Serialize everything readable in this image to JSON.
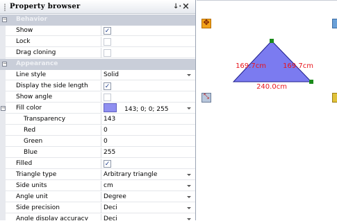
{
  "panel": {
    "title": "Property browser",
    "pin_glyph": "↓·",
    "close_glyph": "×"
  },
  "rows": [
    {
      "type": "category",
      "label": "Behavior",
      "expanded": true
    },
    {
      "type": "check",
      "label": "Show",
      "checked": true
    },
    {
      "type": "check",
      "label": "Lock",
      "checked": false
    },
    {
      "type": "check",
      "label": "Drag cloning",
      "checked": false
    },
    {
      "type": "category",
      "label": "Appearance",
      "expanded": true
    },
    {
      "type": "dropdown",
      "label": "Line style",
      "value": "Solid"
    },
    {
      "type": "check",
      "label": "Display the side length",
      "checked": true
    },
    {
      "type": "check",
      "label": "Show angle",
      "checked": false
    },
    {
      "type": "color",
      "label": "Fill color",
      "value": "143; 0; 0; 255",
      "color": "#8f8ff0",
      "expanded": true
    },
    {
      "type": "text",
      "label": "Transparency",
      "value": "143",
      "sub": true
    },
    {
      "type": "text",
      "label": "Red",
      "value": "0",
      "sub": true
    },
    {
      "type": "text",
      "label": "Green",
      "value": "0",
      "sub": true
    },
    {
      "type": "text",
      "label": "Blue",
      "value": "255",
      "sub": true
    },
    {
      "type": "check",
      "label": "Filled",
      "checked": true
    },
    {
      "type": "dropdown",
      "label": "Triangle type",
      "value": "Arbitrary triangle"
    },
    {
      "type": "dropdown",
      "label": "Side units",
      "value": "cm"
    },
    {
      "type": "dropdown",
      "label": "Angle unit",
      "value": "Degree"
    },
    {
      "type": "dropdown",
      "label": "Side precision",
      "value": "Deci"
    },
    {
      "type": "dropdown",
      "label": "Angle display accuracy",
      "value": "Deci"
    }
  ],
  "canvas": {
    "triangle_fill": "#7b7bf0",
    "triangle_stroke": "#1c1c8a",
    "handle_color": "#1a8a1a",
    "label_color": "#e8141c",
    "labels": {
      "left_side": "169.7cm",
      "right_side": "169.7cm",
      "bottom_side": "240.0cm"
    }
  }
}
